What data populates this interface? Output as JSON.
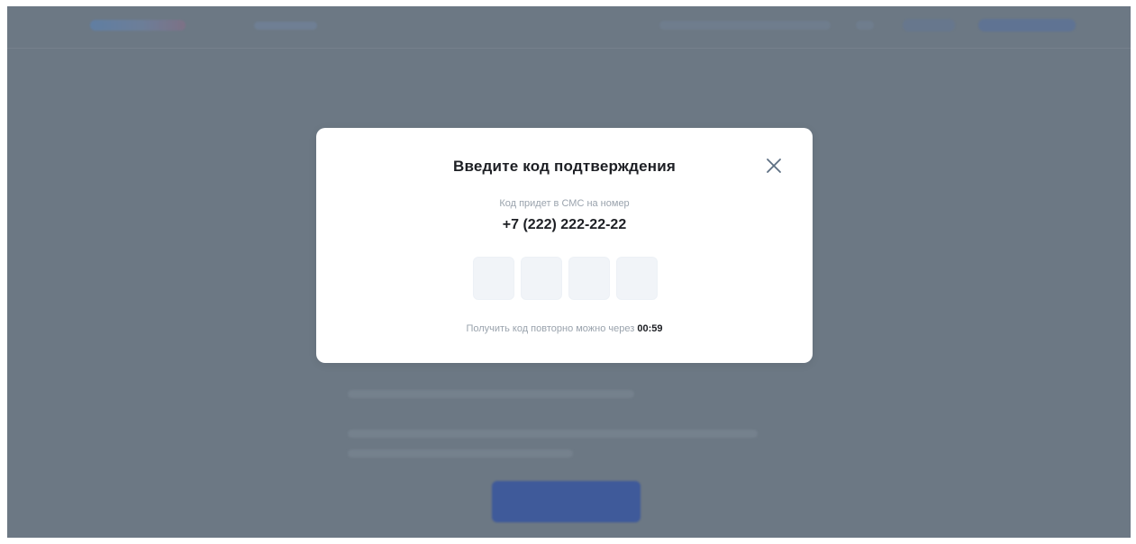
{
  "modal": {
    "title": "Введите код подтверждения",
    "subtitle": "Код придет в СМС на номер",
    "phone": "+7 (222) 222-22-22",
    "code_inputs": [
      "",
      "",
      "",
      ""
    ],
    "resend_text": "Получить код повторно можно через",
    "timer": "00:59",
    "close_icon": "close-icon"
  },
  "colors": {
    "overlay": "#6c7884",
    "modal_bg": "#ffffff",
    "text_primary": "#1d1f24",
    "text_secondary": "#9aa3ad",
    "code_box_bg": "#f1f4f8",
    "close_icon": "#5d6f83"
  }
}
